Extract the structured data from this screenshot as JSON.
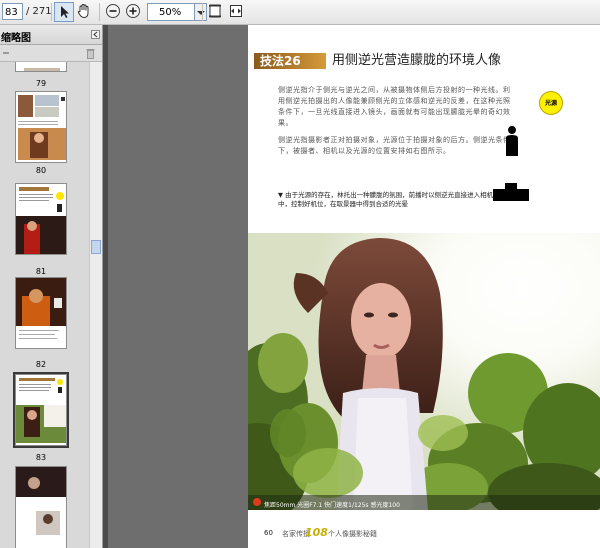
{
  "toolbar": {
    "page_current": "83",
    "page_total": "/ 271",
    "zoom": "50%",
    "icons": [
      "select-arrow-icon",
      "hand-icon",
      "zoom-out-icon",
      "zoom-in-icon",
      "fit-page-icon",
      "fit-width-icon"
    ]
  },
  "sidebar": {
    "title": "缩略图",
    "thumbnails": [
      {
        "label": "79"
      },
      {
        "label": "80"
      },
      {
        "label": "81"
      },
      {
        "label": "82"
      },
      {
        "label": "83",
        "selected": true
      }
    ]
  },
  "page": {
    "badge": "技法26",
    "title": "用侧逆光营造朦胧的环境人像",
    "para1": "侧逆光指介于侧光与逆光之间，从被摄物体侧后方投射的一种光线。利用侧逆光拍摄出的人像能兼顾侧光的立体感和逆光的反差，在这种光照条件下，一旦光线直接进入镜头，画面就有可能出现朦胧光晕的奇幻效果。",
    "para2": "侧逆光指摄影者正对拍摄对象，光源位于拍摄对象的后方。侧逆光条件下，被摄者、相机以及光源的位置安排如右图所示。",
    "caption": "▼ 由于光源的存在，林托出一种朦胧的氛围，前播时以侧逆光直接进入相机镜头当中，控制好机位，在取景器中得到合适的光晕",
    "circle_label": "光源",
    "exif": "焦距50mm  光圈F7.1  快门速度1/125s  感光度100",
    "footer_page": "60",
    "footer_left": "名家传授",
    "footer_big": "108",
    "footer_right": "个人像摄影秘籍"
  }
}
